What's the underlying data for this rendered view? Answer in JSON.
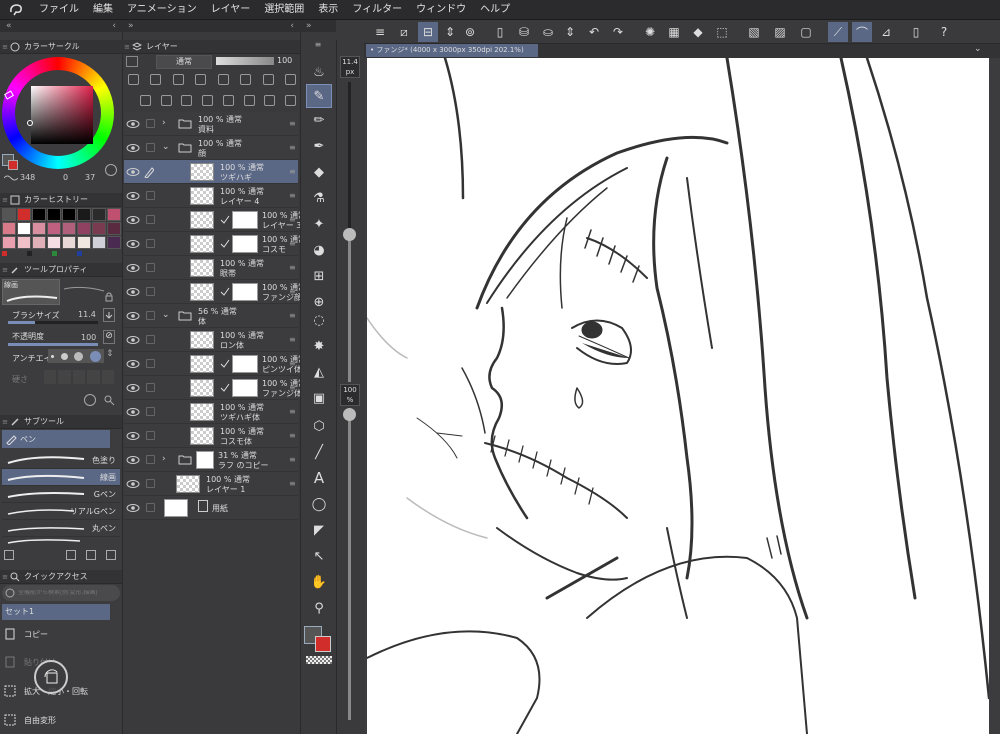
{
  "menu": [
    "ファイル",
    "編集",
    "アニメーション",
    "レイヤー",
    "選択範囲",
    "表示",
    "フィルター",
    "ウィンドウ",
    "ヘルプ"
  ],
  "color_circle": {
    "title": "カラーサークル",
    "hsv": [
      "348",
      "0",
      "37"
    ],
    "main_color": "#d12d2a"
  },
  "color_history": {
    "title": "カラーヒストリー",
    "swatches": [
      "#555555",
      "#d12d2a",
      "#000000",
      "#000000",
      "#000000",
      "#1a1a1a",
      "#2b2b2b",
      "#c05070",
      "#d87a8a",
      "#ffffff",
      "#d890a0",
      "#c06080",
      "#b0607a",
      "#904060",
      "#7a3a50",
      "#5a2a40",
      "#e8a0b0",
      "#f0c0c8",
      "#e0b0b8",
      "#f5dfe4",
      "#e8d8d8",
      "#f0e8e0",
      "#cfd0d8",
      "#4a2a50"
    ],
    "dots": [
      "#d12d2a",
      "#222222",
      "#2a8a3a",
      "#2040a0"
    ]
  },
  "tool_property": {
    "title": "ツールプロパティ",
    "tool_name": "線画",
    "brush_size_label": "ブラシサイズ",
    "brush_size": "11.4",
    "opacity_label": "不透明度",
    "opacity": "100",
    "antialias_label": "アンチエイリ",
    "strength_label": "硬さ"
  },
  "subtool": {
    "title": "サブツール",
    "group": "ペン",
    "brushes": [
      "色塗り",
      "線画",
      "Gペン",
      "リアルGペン",
      "丸ペン"
    ]
  },
  "quick_access": {
    "title": "クイックアクセス",
    "search_placeholder": "全機能から検索(例:変形,描画)",
    "set_name": "セット1",
    "items": [
      "コピー",
      "貼り付け",
      "拡大・縮小・回転",
      "自由変形"
    ]
  },
  "layer_panel": {
    "title": "レイヤー",
    "blend": "通常",
    "opacity": "100",
    "layers": [
      {
        "pct": "100 %",
        "mode": "通常",
        "name": "資料",
        "type": "folder",
        "collapsed": true
      },
      {
        "pct": "100 %",
        "mode": "通常",
        "name": "顔",
        "type": "folder",
        "collapsed": false
      },
      {
        "pct": "100 %",
        "mode": "通常",
        "name": "ツギハギ",
        "type": "layer",
        "selected": true
      },
      {
        "pct": "100 %",
        "mode": "通常",
        "name": "レイヤー 4",
        "type": "layer"
      },
      {
        "pct": "100 %",
        "mode": "通常",
        "name": "レイヤー 3",
        "type": "mask"
      },
      {
        "pct": "100 %",
        "mode": "通常",
        "name": "コスモ",
        "type": "mask"
      },
      {
        "pct": "100 %",
        "mode": "通常",
        "name": "眼帯",
        "type": "layer"
      },
      {
        "pct": "100 %",
        "mode": "通常",
        "name": "ファンジ顔",
        "type": "mask"
      },
      {
        "pct": "56 %",
        "mode": "通常",
        "name": "体",
        "type": "folder",
        "collapsed": false
      },
      {
        "pct": "100 %",
        "mode": "通常",
        "name": "ロン体",
        "type": "layer"
      },
      {
        "pct": "100 %",
        "mode": "通常",
        "name": "ピンツイ体",
        "type": "mask"
      },
      {
        "pct": "100 %",
        "mode": "通常",
        "name": "ファンジ体",
        "type": "mask"
      },
      {
        "pct": "100 %",
        "mode": "通常",
        "name": "ツギハギ体",
        "type": "layer"
      },
      {
        "pct": "100 %",
        "mode": "通常",
        "name": "コスモ体",
        "type": "layer"
      },
      {
        "pct": "31 %",
        "mode": "通常",
        "name": "ラフ のコピー",
        "type": "folder",
        "collapsed": true
      },
      {
        "pct": "100 %",
        "mode": "通常",
        "name": "レイヤー 1",
        "type": "layer"
      },
      {
        "pct": "",
        "mode": "",
        "name": "用紙",
        "type": "paper"
      }
    ]
  },
  "canvas": {
    "tab_title": "ファンジ* (4000 x 3000px 350dpi 202.1%)",
    "size_label": "11.4",
    "size_unit": "px",
    "opacity_label": "100",
    "opacity_unit": "%"
  }
}
